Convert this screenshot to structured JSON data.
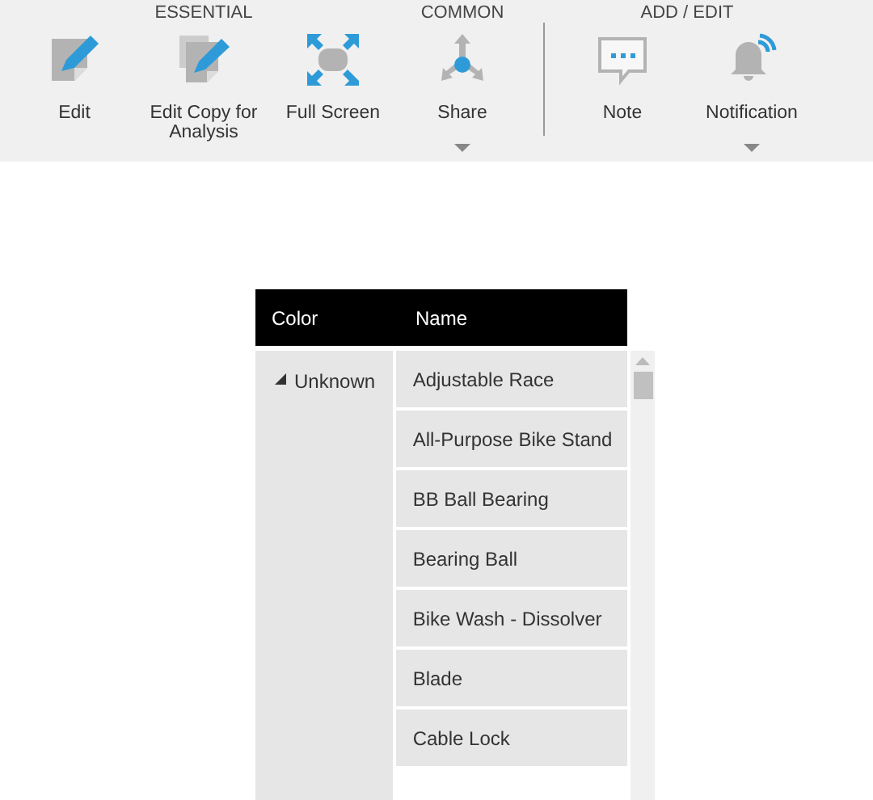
{
  "toolbar": {
    "groups": [
      {
        "title": "ESSENTIAL",
        "items": [
          {
            "label": "Edit",
            "dropdown": false
          },
          {
            "label": "Edit Copy for Analysis",
            "dropdown": false
          },
          {
            "label": "Full Screen",
            "dropdown": false
          }
        ]
      },
      {
        "title": "COMMON",
        "items": [
          {
            "label": "Share",
            "dropdown": true
          }
        ]
      },
      {
        "title": "ADD / EDIT",
        "items": [
          {
            "label": "Note",
            "dropdown": false
          },
          {
            "label": "Notification",
            "dropdown": true
          }
        ]
      }
    ]
  },
  "table": {
    "columns": [
      "Color",
      "Name"
    ],
    "groups": [
      {
        "label": "Unknown",
        "expanded": true,
        "rows": [
          "Adjustable Race",
          "All-Purpose Bike Stand",
          "BB Ball Bearing",
          "Bearing Ball",
          "Bike Wash - Dissolver",
          "Blade",
          "Cable Lock"
        ]
      }
    ]
  }
}
